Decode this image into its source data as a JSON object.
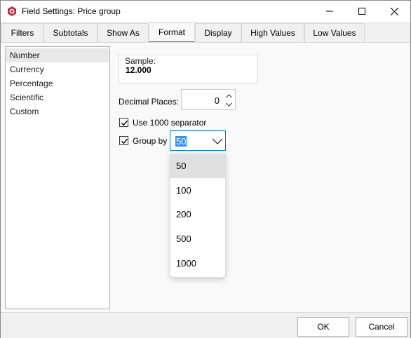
{
  "window": {
    "title": "Field Settings: Price group",
    "icon": "app-logo-icon",
    "controls": [
      "minimize-icon",
      "maximize-icon",
      "close-icon"
    ]
  },
  "tabs": [
    {
      "label": "Filters"
    },
    {
      "label": "Subtotals"
    },
    {
      "label": "Show As"
    },
    {
      "label": "Format",
      "active": true
    },
    {
      "label": "Display"
    },
    {
      "label": "High Values"
    },
    {
      "label": "Low Values"
    }
  ],
  "categories": {
    "items": [
      "Number",
      "Currency",
      "Percentage",
      "Scientific",
      "Custom"
    ],
    "selected": "Number"
  },
  "sample": {
    "label": "Sample:",
    "value": "12.000"
  },
  "decimal_places": {
    "label": "Decimal Places:",
    "value": "0"
  },
  "use_separator": {
    "label": "Use 1000 separator",
    "checked": true
  },
  "group_by": {
    "label": "Group by",
    "checked": true,
    "value": "50",
    "options": [
      "50",
      "100",
      "200",
      "500",
      "1000"
    ],
    "highlighted": "50"
  },
  "buttons": {
    "ok": "OK",
    "cancel": "Cancel"
  },
  "colors": {
    "accent": "#0078d4",
    "tab_underline": "#2b7cd3",
    "selection": "#3390ff",
    "app_icon": "#c4283e"
  }
}
